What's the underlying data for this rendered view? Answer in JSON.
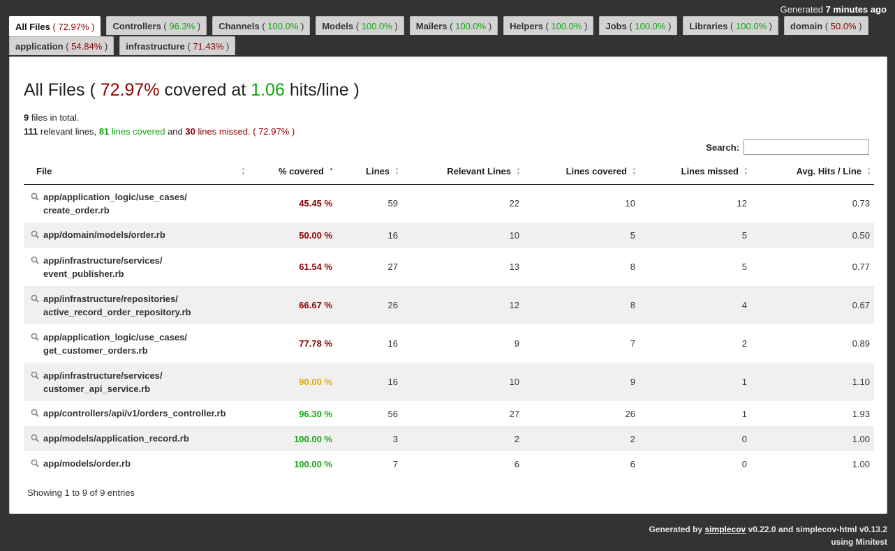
{
  "timestamp": {
    "prefix": "Generated",
    "value": "7 minutes ago"
  },
  "tabs_row1": [
    {
      "name": "All Files",
      "pct": "72.97%",
      "color": "red",
      "active": true
    },
    {
      "name": "Controllers",
      "pct": "96.3%",
      "color": "green"
    },
    {
      "name": "Channels",
      "pct": "100.0%",
      "color": "green"
    },
    {
      "name": "Models",
      "pct": "100.0%",
      "color": "green"
    },
    {
      "name": "Mailers",
      "pct": "100.0%",
      "color": "green"
    },
    {
      "name": "Helpers",
      "pct": "100.0%",
      "color": "green"
    },
    {
      "name": "Jobs",
      "pct": "100.0%",
      "color": "green"
    },
    {
      "name": "Libraries",
      "pct": "100.0%",
      "color": "green"
    },
    {
      "name": "domain",
      "pct": "50.0%",
      "color": "red"
    }
  ],
  "tabs_row2": [
    {
      "name": "application",
      "pct": "54.84%",
      "color": "red"
    },
    {
      "name": "infrastructure",
      "pct": "71.43%",
      "color": "red"
    }
  ],
  "title": {
    "prefix": "All Files (",
    "percent": "72.97%",
    "middle": "covered at",
    "hits": "1.06",
    "suffix": "hits/line )"
  },
  "summary": {
    "files_count": "9",
    "files_text": "files in total.",
    "relevant": "111",
    "relevant_text": "relevant lines,",
    "covered": "81",
    "covered_text": "lines covered",
    "and_text": "and",
    "missed": "30",
    "missed_text": "lines missed.",
    "pct": "( 72.97% )"
  },
  "search": {
    "label": "Search:",
    "value": ""
  },
  "columns": [
    "File",
    "% covered",
    "Lines",
    "Relevant Lines",
    "Lines covered",
    "Lines missed",
    "Avg. Hits / Line"
  ],
  "rows": [
    {
      "file1": "app/application_logic/use_cases/",
      "file2": "create_order.rb",
      "pct": "45.45 %",
      "color": "red",
      "lines": "59",
      "relevant": "22",
      "covered": "10",
      "missed": "12",
      "avg": "0.73"
    },
    {
      "file1": "app/domain/models/order.rb",
      "file2": "",
      "pct": "50.00 %",
      "color": "red",
      "lines": "16",
      "relevant": "10",
      "covered": "5",
      "missed": "5",
      "avg": "0.50"
    },
    {
      "file1": "app/infrastructure/services/",
      "file2": "event_publisher.rb",
      "pct": "61.54 %",
      "color": "red",
      "lines": "27",
      "relevant": "13",
      "covered": "8",
      "missed": "5",
      "avg": "0.77"
    },
    {
      "file1": "app/infrastructure/repositories/",
      "file2": "active_record_order_repository.rb",
      "pct": "66.67 %",
      "color": "red",
      "lines": "26",
      "relevant": "12",
      "covered": "8",
      "missed": "4",
      "avg": "0.67"
    },
    {
      "file1": "app/application_logic/use_cases/",
      "file2": "get_customer_orders.rb",
      "pct": "77.78 %",
      "color": "red",
      "lines": "16",
      "relevant": "9",
      "covered": "7",
      "missed": "2",
      "avg": "0.89"
    },
    {
      "file1": "app/infrastructure/services/",
      "file2": "customer_api_service.rb",
      "pct": "90.00 %",
      "color": "yellow",
      "lines": "16",
      "relevant": "10",
      "covered": "9",
      "missed": "1",
      "avg": "1.10"
    },
    {
      "file1": "app/controllers/api/v1/orders_controller.rb",
      "file2": "",
      "pct": "96.30 %",
      "color": "green",
      "lines": "56",
      "relevant": "27",
      "covered": "26",
      "missed": "1",
      "avg": "1.93"
    },
    {
      "file1": "app/models/application_record.rb",
      "file2": "",
      "pct": "100.00 %",
      "color": "green",
      "lines": "3",
      "relevant": "2",
      "covered": "2",
      "missed": "0",
      "avg": "1.00"
    },
    {
      "file1": "app/models/order.rb",
      "file2": "",
      "pct": "100.00 %",
      "color": "green",
      "lines": "7",
      "relevant": "6",
      "covered": "6",
      "missed": "0",
      "avg": "1.00"
    }
  ],
  "showing": "Showing 1 to 9 of 9 entries",
  "footer": {
    "generated_by": "Generated by",
    "simplecov_link": "simplecov",
    "versions": "v0.22.0 and simplecov-html v0.13.2",
    "using": "using Minitest"
  },
  "colors": {
    "green": "#11a611",
    "red": "#8b0000",
    "yellow": "#e3a900",
    "background": "#333333"
  }
}
